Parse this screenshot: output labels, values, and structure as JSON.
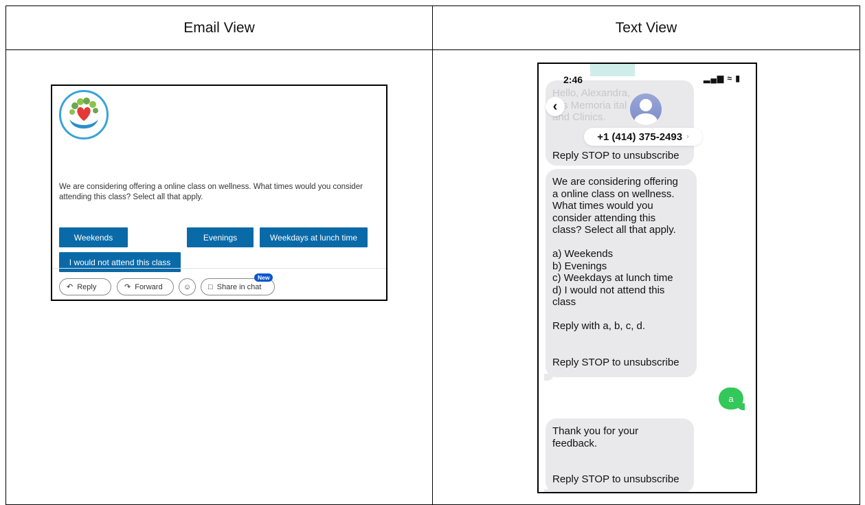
{
  "table": {
    "headers": [
      "Email View",
      "Text View"
    ]
  },
  "email": {
    "message": "We are considering offering a online class on wellness. What times would you consider attending this class? Select all that apply.",
    "buttons": [
      "Weekends",
      "Evenings",
      "Weekdays at lunch time",
      "I would not attend this class"
    ],
    "button_color": "#0a6aa8",
    "actions": {
      "reply": "Reply",
      "forward": "Forward",
      "share": "Share in chat",
      "new_badge": "New"
    }
  },
  "phone": {
    "time": "2:46",
    "status_icons": "signal-icon wifi-icon battery-icon",
    "contact": "+1 (414) 375-2493",
    "first_message": {
      "ghost_lines": [
        "Hello, Alexandra,",
        "  s is Memoria    ital",
        "and Clinics."
      ],
      "stop": "Reply STOP to unsubscribe"
    },
    "survey_message": {
      "lines": [
        "We are considering offering",
        "a online class on wellness.",
        "What times would you",
        "consider attending this",
        "class? Select all that apply."
      ],
      "options": [
        "a) Weekends",
        "b) Evenings",
        "c) Weekdays at lunch time",
        "d) I would not attend this",
        "class"
      ],
      "prompt": "Reply with a, b, c, d.",
      "stop": "Reply STOP to unsubscribe"
    },
    "reply": "a",
    "reply_color": "#34c759",
    "thanks_message": {
      "lines": [
        "Thank you for your",
        "feedback."
      ],
      "stop": "Reply STOP to unsubscribe"
    }
  }
}
